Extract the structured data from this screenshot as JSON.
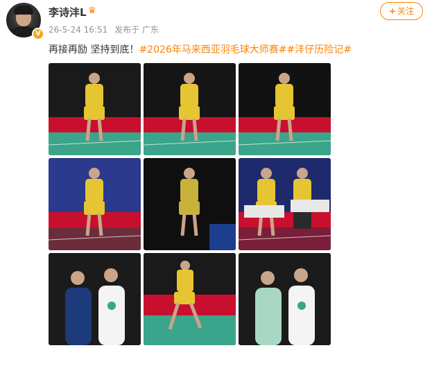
{
  "user": {
    "name": "李诗沣L",
    "badge": "V"
  },
  "meta": {
    "time": "26-5-24 16:51",
    "source": "发布于 广东"
  },
  "follow_button": {
    "plus": "+",
    "label": "关注"
  },
  "content": {
    "text": "再接再励 坚持到底！",
    "hashtags": [
      "#2026年马来西亚羽毛球大师赛#",
      "#沣仔历险记#"
    ]
  },
  "photos": [
    {
      "name": "photo-smash-jump",
      "colors": {
        "bg": "#1a1a1a",
        "floor": "#3aa58a",
        "board": "#c8102e",
        "player": "#e6c532"
      }
    },
    {
      "name": "photo-lunge-net",
      "colors": {
        "bg": "#151515",
        "floor": "#3aa58a",
        "board": "#c8102e",
        "player": "#e6c532"
      }
    },
    {
      "name": "photo-dive",
      "colors": {
        "bg": "#121212",
        "floor": "#3aa58a",
        "board": "#c8102e",
        "player": "#e6c532"
      }
    },
    {
      "name": "photo-trophy-seated",
      "colors": {
        "bg": "#2b3a8c",
        "floor": "#6b2d3a",
        "board": "#c8102e",
        "player": "#e6c532"
      }
    },
    {
      "name": "photo-hug",
      "colors": {
        "bg": "#0f0f0f",
        "floor": "#0f0f0f",
        "board": "#1d3d8f",
        "player": "#c9b23a"
      }
    },
    {
      "name": "photo-podium",
      "colors": {
        "bg": "#1e2a6b",
        "floor": "#7a1e3a",
        "board": "#c8102e",
        "player": "#e6c532"
      }
    },
    {
      "name": "photo-with-coach",
      "colors": {
        "bg": "#1b1b1b",
        "floor": "#1b1b1b",
        "board": "#1b1b1b",
        "player": "#ffffff"
      }
    },
    {
      "name": "photo-backhand",
      "colors": {
        "bg": "#1a1a1a",
        "floor": "#3aa58a",
        "board": "#c8102e",
        "player": "#e6c532"
      }
    },
    {
      "name": "photo-with-teammate",
      "colors": {
        "bg": "#1b1b1b",
        "floor": "#1b1b1b",
        "board": "#1b1b1b",
        "player": "#ffffff"
      }
    }
  ]
}
